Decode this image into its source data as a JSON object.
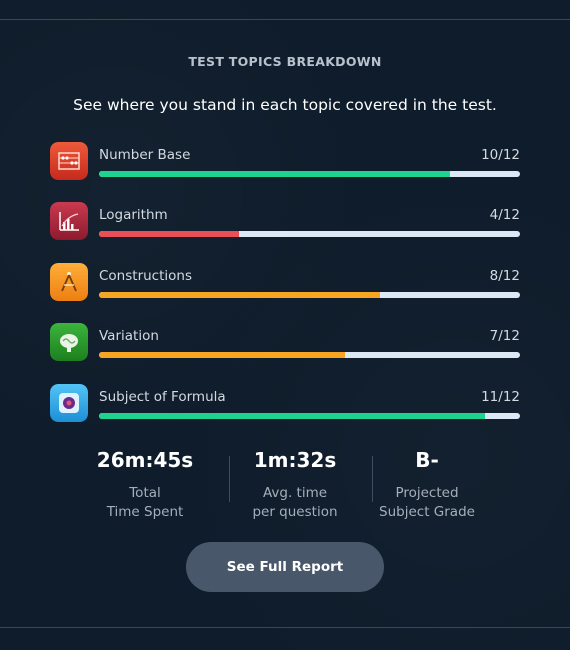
{
  "section": {
    "heading": "TEST TOPICS BREAKDOWN",
    "subheading": "See where you stand in each topic covered in the test."
  },
  "topics": [
    {
      "name": "Number Base",
      "score": "10/12",
      "fraction": 0.8333,
      "bar_color": "#1ed38f",
      "icon": "abacus-icon",
      "icon_color": "#e2402e"
    },
    {
      "name": "Logarithm",
      "score": "4/12",
      "fraction": 0.3333,
      "bar_color": "#ea4f57",
      "icon": "log-graph-icon",
      "icon_color": "#b0203a"
    },
    {
      "name": "Constructions",
      "score": "8/12",
      "fraction": 0.6667,
      "bar_color": "#f6a623",
      "icon": "compass-icon",
      "icon_color": "#f39a1d"
    },
    {
      "name": "Variation",
      "score": "7/12",
      "fraction": 0.5833,
      "bar_color": "#f6a623",
      "icon": "brain-icon",
      "icon_color": "#2a9a2a"
    },
    {
      "name": "Subject of Formula",
      "score": "11/12",
      "fraction": 0.9167,
      "bar_color": "#1ed38f",
      "icon": "formula-icon",
      "icon_color": "#2aa3e6"
    }
  ],
  "stats": {
    "total_time_value": "26m:45s",
    "total_time_label_line1": "Total",
    "total_time_label_line2": "Time Spent",
    "avg_time_value": "1m:32s",
    "avg_time_label_line1": "Avg. time",
    "avg_time_label_line2": "per question",
    "grade_value": "B-",
    "grade_label_line1": "Projected",
    "grade_label_line2": "Subject Grade"
  },
  "actions": {
    "full_report_label": "See Full Report"
  }
}
